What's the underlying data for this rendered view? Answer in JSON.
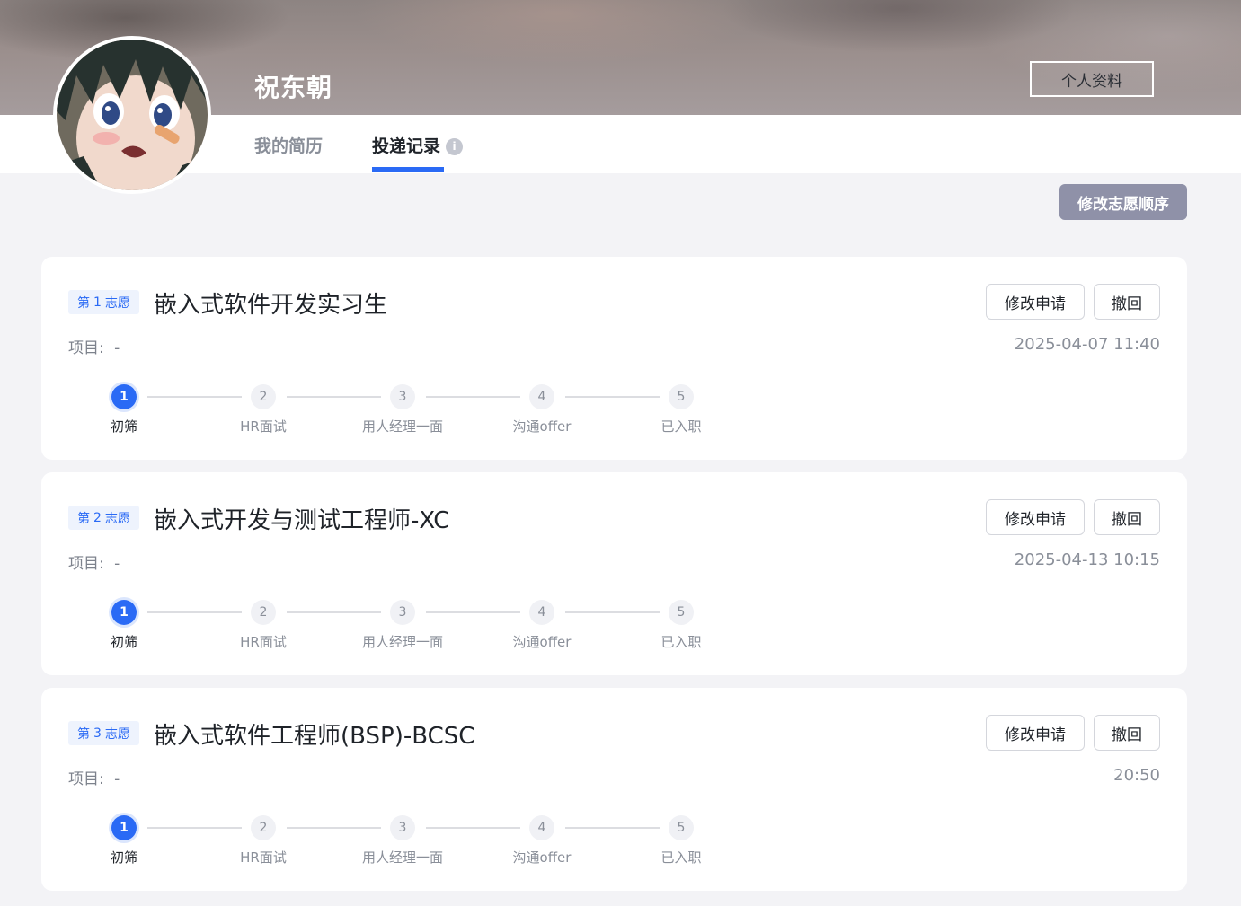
{
  "header": {
    "user_name": "祝东朝",
    "profile_button": "个人资料"
  },
  "tabs": [
    {
      "label": "我的简历",
      "active": false
    },
    {
      "label": "投递记录",
      "active": true
    }
  ],
  "change_order_button": "修改志愿顺序",
  "steps": [
    "初筛",
    "HR面试",
    "用人经理一面",
    "沟通offer",
    "已入职"
  ],
  "applications": [
    {
      "choice_prefix": "第",
      "choice_num": "1",
      "choice_suffix": "志愿",
      "title": "嵌入式软件开发实习生",
      "project_label": "项目:",
      "project_value": "-",
      "date": "2025-04-07 11:40",
      "edit_label": "修改申请",
      "withdraw_label": "撤回",
      "current_step": 1
    },
    {
      "choice_prefix": "第",
      "choice_num": "2",
      "choice_suffix": "志愿",
      "title": "嵌入式开发与测试工程师-XC",
      "project_label": "项目:",
      "project_value": "-",
      "date": "2025-04-13 10:15",
      "edit_label": "修改申请",
      "withdraw_label": "撤回",
      "current_step": 1
    },
    {
      "choice_prefix": "第",
      "choice_num": "3",
      "choice_suffix": "志愿",
      "title": "嵌入式软件工程师(BSP)-BCSC",
      "project_label": "项目:",
      "project_value": "-",
      "date": "20:50",
      "edit_label": "修改申请",
      "withdraw_label": "撤回",
      "current_step": 1
    }
  ],
  "colors": {
    "accent": "#2a6af5",
    "order_button": "#8f91a8",
    "page_bg": "#f3f3f6"
  }
}
